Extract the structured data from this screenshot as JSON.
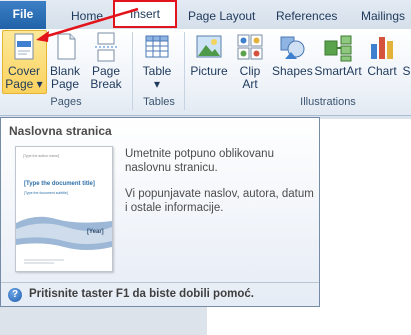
{
  "tabs": {
    "file": "File",
    "home": "Home",
    "insert": "Insert",
    "page_layout": "Page Layout",
    "references": "References",
    "mailings": "Mailings"
  },
  "ribbon": {
    "pages": {
      "cover_page": [
        "Cover",
        "Page ▾"
      ],
      "blank_page": [
        "Blank",
        "Page"
      ],
      "page_break": [
        "Page",
        "Break"
      ],
      "group_label": "Pages"
    },
    "tables": {
      "table": [
        "Table",
        "▾"
      ],
      "group_label": "Tables"
    },
    "illustrations": {
      "picture": "Picture",
      "clip_art": [
        "Clip",
        "Art"
      ],
      "shapes": "Shapes",
      "smartart": "SmartArt",
      "chart": "Chart",
      "cut_off": "S",
      "group_label": "Illustrations"
    }
  },
  "tooltip": {
    "title": "Naslovna stranica",
    "desc1": "Umetnite potpuno oblikovanu naslovnu stranicu.",
    "desc2": "Vi popunjavate naslov, autora, datum i ostale informacije.",
    "thumb": {
      "date_label": "[Type the author name]",
      "title": "[Type the document title]",
      "subtitle": "[Type the document subtitle]",
      "year": "[Year]"
    },
    "help": "Pritisnite taster F1 da biste dobili pomoć."
  },
  "colors": {
    "highlight_box": "#e3131b",
    "arrow": "#e3131b",
    "file_tab": "#2a6db5"
  }
}
